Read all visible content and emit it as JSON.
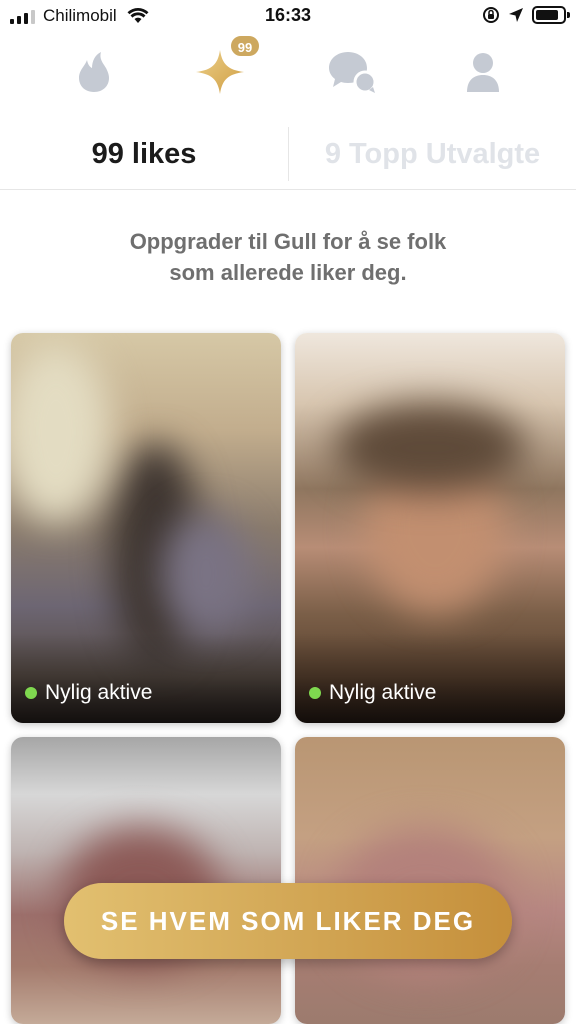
{
  "status_bar": {
    "carrier": "Chilimobil",
    "time": "16:33",
    "battery_level": 0.85,
    "icons": [
      "signal-icon",
      "wifi-icon",
      "orientation-lock-icon",
      "location-icon",
      "battery-icon"
    ]
  },
  "nav": {
    "items": [
      {
        "name": "flame",
        "icon": "flame-icon"
      },
      {
        "name": "likes",
        "icon": "gold-sparkle-icon"
      },
      {
        "name": "messages",
        "icon": "chat-bubbles-icon"
      },
      {
        "name": "profile",
        "icon": "person-icon"
      }
    ],
    "likes_badge": "99",
    "colors": {
      "inactive": "#c5cad3",
      "gold": "#cda85f"
    }
  },
  "tabs": {
    "likes": "99 likes",
    "top_picks": "9 Topp Utvalgte"
  },
  "upgrade_message": {
    "line1": "Oppgrader til Gull for å se folk",
    "line2": "som allerede liker deg."
  },
  "cards": [
    {
      "status": "Nylig aktive"
    },
    {
      "status": "Nylig aktive"
    },
    {
      "status": ""
    },
    {
      "status": ""
    }
  ],
  "cta": {
    "label": "SE HVEM SOM LIKER DEG"
  },
  "colors": {
    "active_dot": "#7fd84f",
    "gold_start": "#e2c070",
    "gold_end": "#c58f3b"
  }
}
